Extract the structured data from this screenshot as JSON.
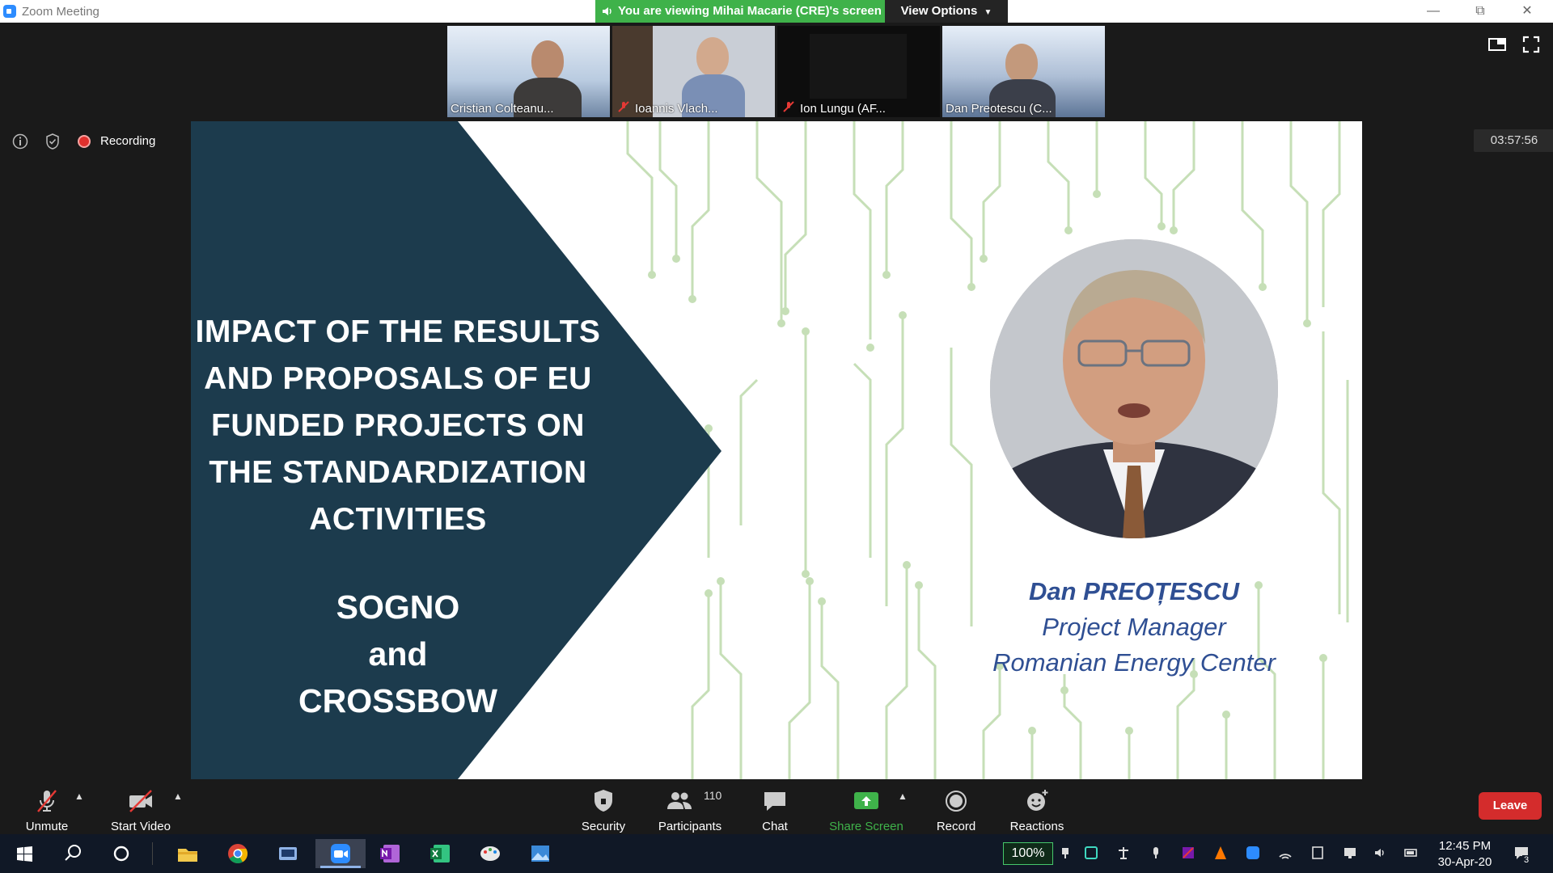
{
  "titlebar": {
    "app_title": "Zoom Meeting",
    "viewing_banner": "You are viewing Mihai Macarie (CRE)'s screen",
    "view_options": "View Options"
  },
  "gallery": [
    {
      "name": "Cristian Colteanu...",
      "muted": false
    },
    {
      "name": "Ioannis Vlach...",
      "muted": true
    },
    {
      "name": "Ion Lungu (AF...",
      "muted": true
    },
    {
      "name": "Dan Preotescu (C...",
      "muted": false
    }
  ],
  "status": {
    "recording_label": "Recording",
    "timer": "03:57:56"
  },
  "slide": {
    "title_lines": [
      "IMPACT OF THE RESULTS",
      "AND PROPOSALS OF EU",
      "FUNDED PROJECTS ON",
      "THE STANDARDIZATION",
      "ACTIVITIES"
    ],
    "subtitle_lines": [
      "SOGNO",
      "and",
      "CROSSBOW"
    ],
    "speaker_name": "Dan PREOȚESCU",
    "speaker_role": "Project Manager",
    "speaker_org": "Romanian Energy Center",
    "colors": {
      "panel": "#1c3b4d",
      "text_blue": "#2f4f93",
      "circuit": "#b9d6a9"
    }
  },
  "toolbar": {
    "unmute": "Unmute",
    "start_video": "Start Video",
    "security": "Security",
    "participants": "Participants",
    "participants_count": "110",
    "chat": "Chat",
    "share_screen": "Share Screen",
    "record": "Record",
    "reactions": "Reactions",
    "leave": "Leave",
    "share_color": "#3fb24a",
    "leave_color": "#d42c2c"
  },
  "taskbar": {
    "apps": [
      "windows-start-icon",
      "search-icon",
      "cortana-icon",
      "file-explorer-icon",
      "chrome-icon",
      "network-tool-icon",
      "zoom-icon",
      "onenote-icon",
      "excel-icon",
      "paint-icon",
      "photos-icon"
    ],
    "zoom_level": "100%",
    "time": "12:45 PM",
    "date": "30-Apr-20",
    "notification_count": "3"
  }
}
